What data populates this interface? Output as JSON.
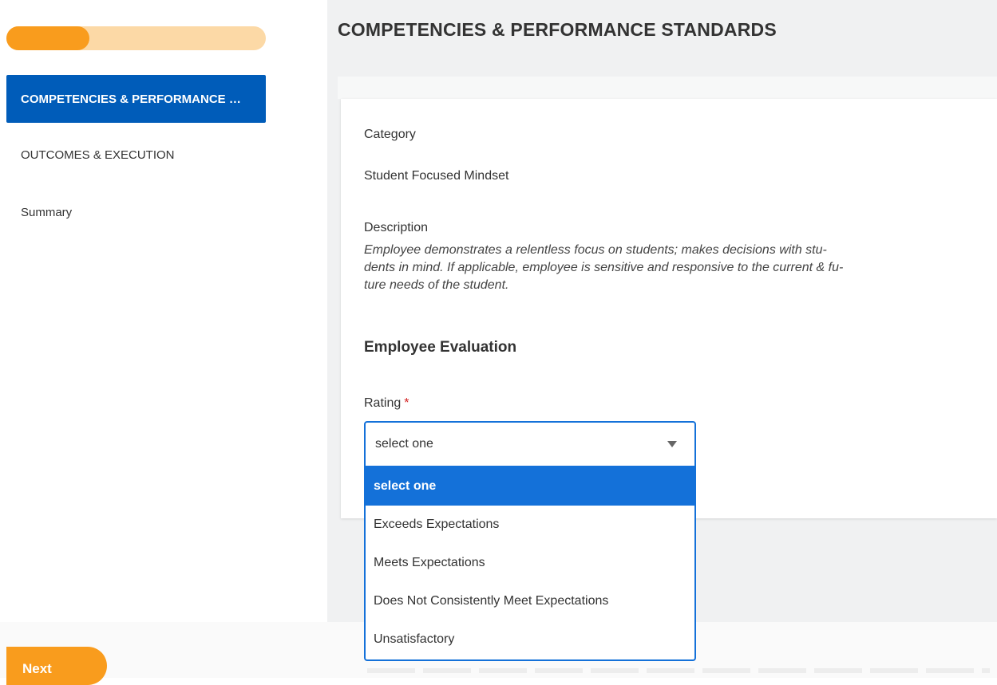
{
  "progress": {
    "fraction": 0.32
  },
  "sidebar": {
    "items": [
      {
        "label": "COMPETENCIES & PERFORMANCE STANDARDS"
      },
      {
        "label": "OUTCOMES & EXECUTION"
      },
      {
        "label": "Summary"
      }
    ]
  },
  "page": {
    "title": "COMPETENCIES & PERFORMANCE STANDARDS"
  },
  "card": {
    "category_label": "Category",
    "category_value": "Student Focused Mindset",
    "description_label": "Description",
    "description_lines": [
      "Employee demonstrates a relentless focus on students; makes decisions with stu-",
      "dents in mind. If applicable, employee is sensitive and responsive to the current & fu-",
      "ture needs of the student."
    ],
    "section_title": "Employee Evaluation",
    "rating_label": "Rating",
    "required_mark": "*"
  },
  "rating_select": {
    "value": "select one",
    "options": [
      "select one",
      "Exceeds Expectations",
      "Meets Expectations",
      "Does Not Consistently Meet Expectations",
      "Unsatisfactory"
    ],
    "selected_index": 0
  },
  "footer": {
    "next_label": "Next"
  },
  "colors": {
    "brand_blue": "#005cb9",
    "focus_blue": "#1471d9",
    "accent_orange": "#f99c1d",
    "required_red": "#d21f1f"
  }
}
